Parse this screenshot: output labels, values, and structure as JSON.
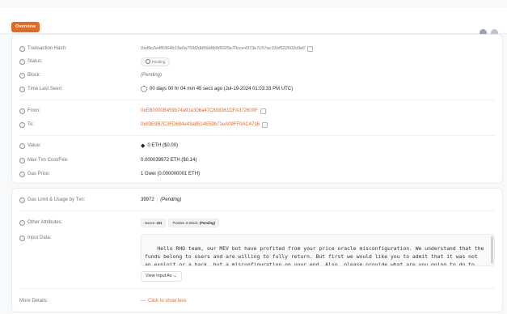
{
  "tabs": {
    "overview": "Overview"
  },
  "details": {
    "tx_hash": {
      "label": "Transaction Hash:",
      "value": "0xd9c2e4f6364b13a0a759f2dd56b8b5f5025e70cce4373e7c57ac31bf522602d3e0"
    },
    "status": {
      "label": "Status:",
      "value": "Pending"
    },
    "block": {
      "label": "Block:",
      "value": "(Pending)"
    },
    "time": {
      "label": "Time Last Seen:",
      "value": "00 days 00 hr 04 min 45 secs ago (Jul-19-2024 01:03:33 PM UTC)"
    },
    "from": {
      "label": "From:",
      "value": "0xEB0000B459b74a91e306a47C808361DFA372600F"
    },
    "to": {
      "label": "To:",
      "value": "0x83E9B7C3FD684e43a8514E59b71eA09FF0AC4716"
    },
    "value": {
      "label": "Value:",
      "value": "0 ETH ($0.00)"
    },
    "max_fee": {
      "label": "Max Txn Cost/Fee:",
      "value": "0.000039972 ETH ($0.14)"
    },
    "gas_price": {
      "label": "Gas Price:",
      "value": "1 Gwei (0.000000001 ETH)"
    }
  },
  "more": {
    "gas_limit": {
      "label": "Gas Limit & Usage by Txn:",
      "value": "39972",
      "usage": "(Pending)"
    },
    "other": {
      "label": "Other Attributes:",
      "nonce_label": "Nonce:",
      "nonce": "221",
      "position_label": "Position In Block:",
      "position": "(Pending)"
    },
    "input": {
      "label": "Input Data:",
      "text": "Hello RHO team, our MEV bot have profited from your price oracle misconfiguration. We understand that the\nfunds belong to users and are willing to fully return. But first we would like you to admit that it was not\nan exploit or a hack, but a misconfiguration on your end. Also, please provide what are you going to do to\nprevent it from happening again.",
      "view_button": "View Input As"
    },
    "details": {
      "label": "More Details:",
      "link": "Click to show less"
    }
  },
  "colors": {
    "accent": "#e06a27",
    "muted": "#6c757d"
  }
}
